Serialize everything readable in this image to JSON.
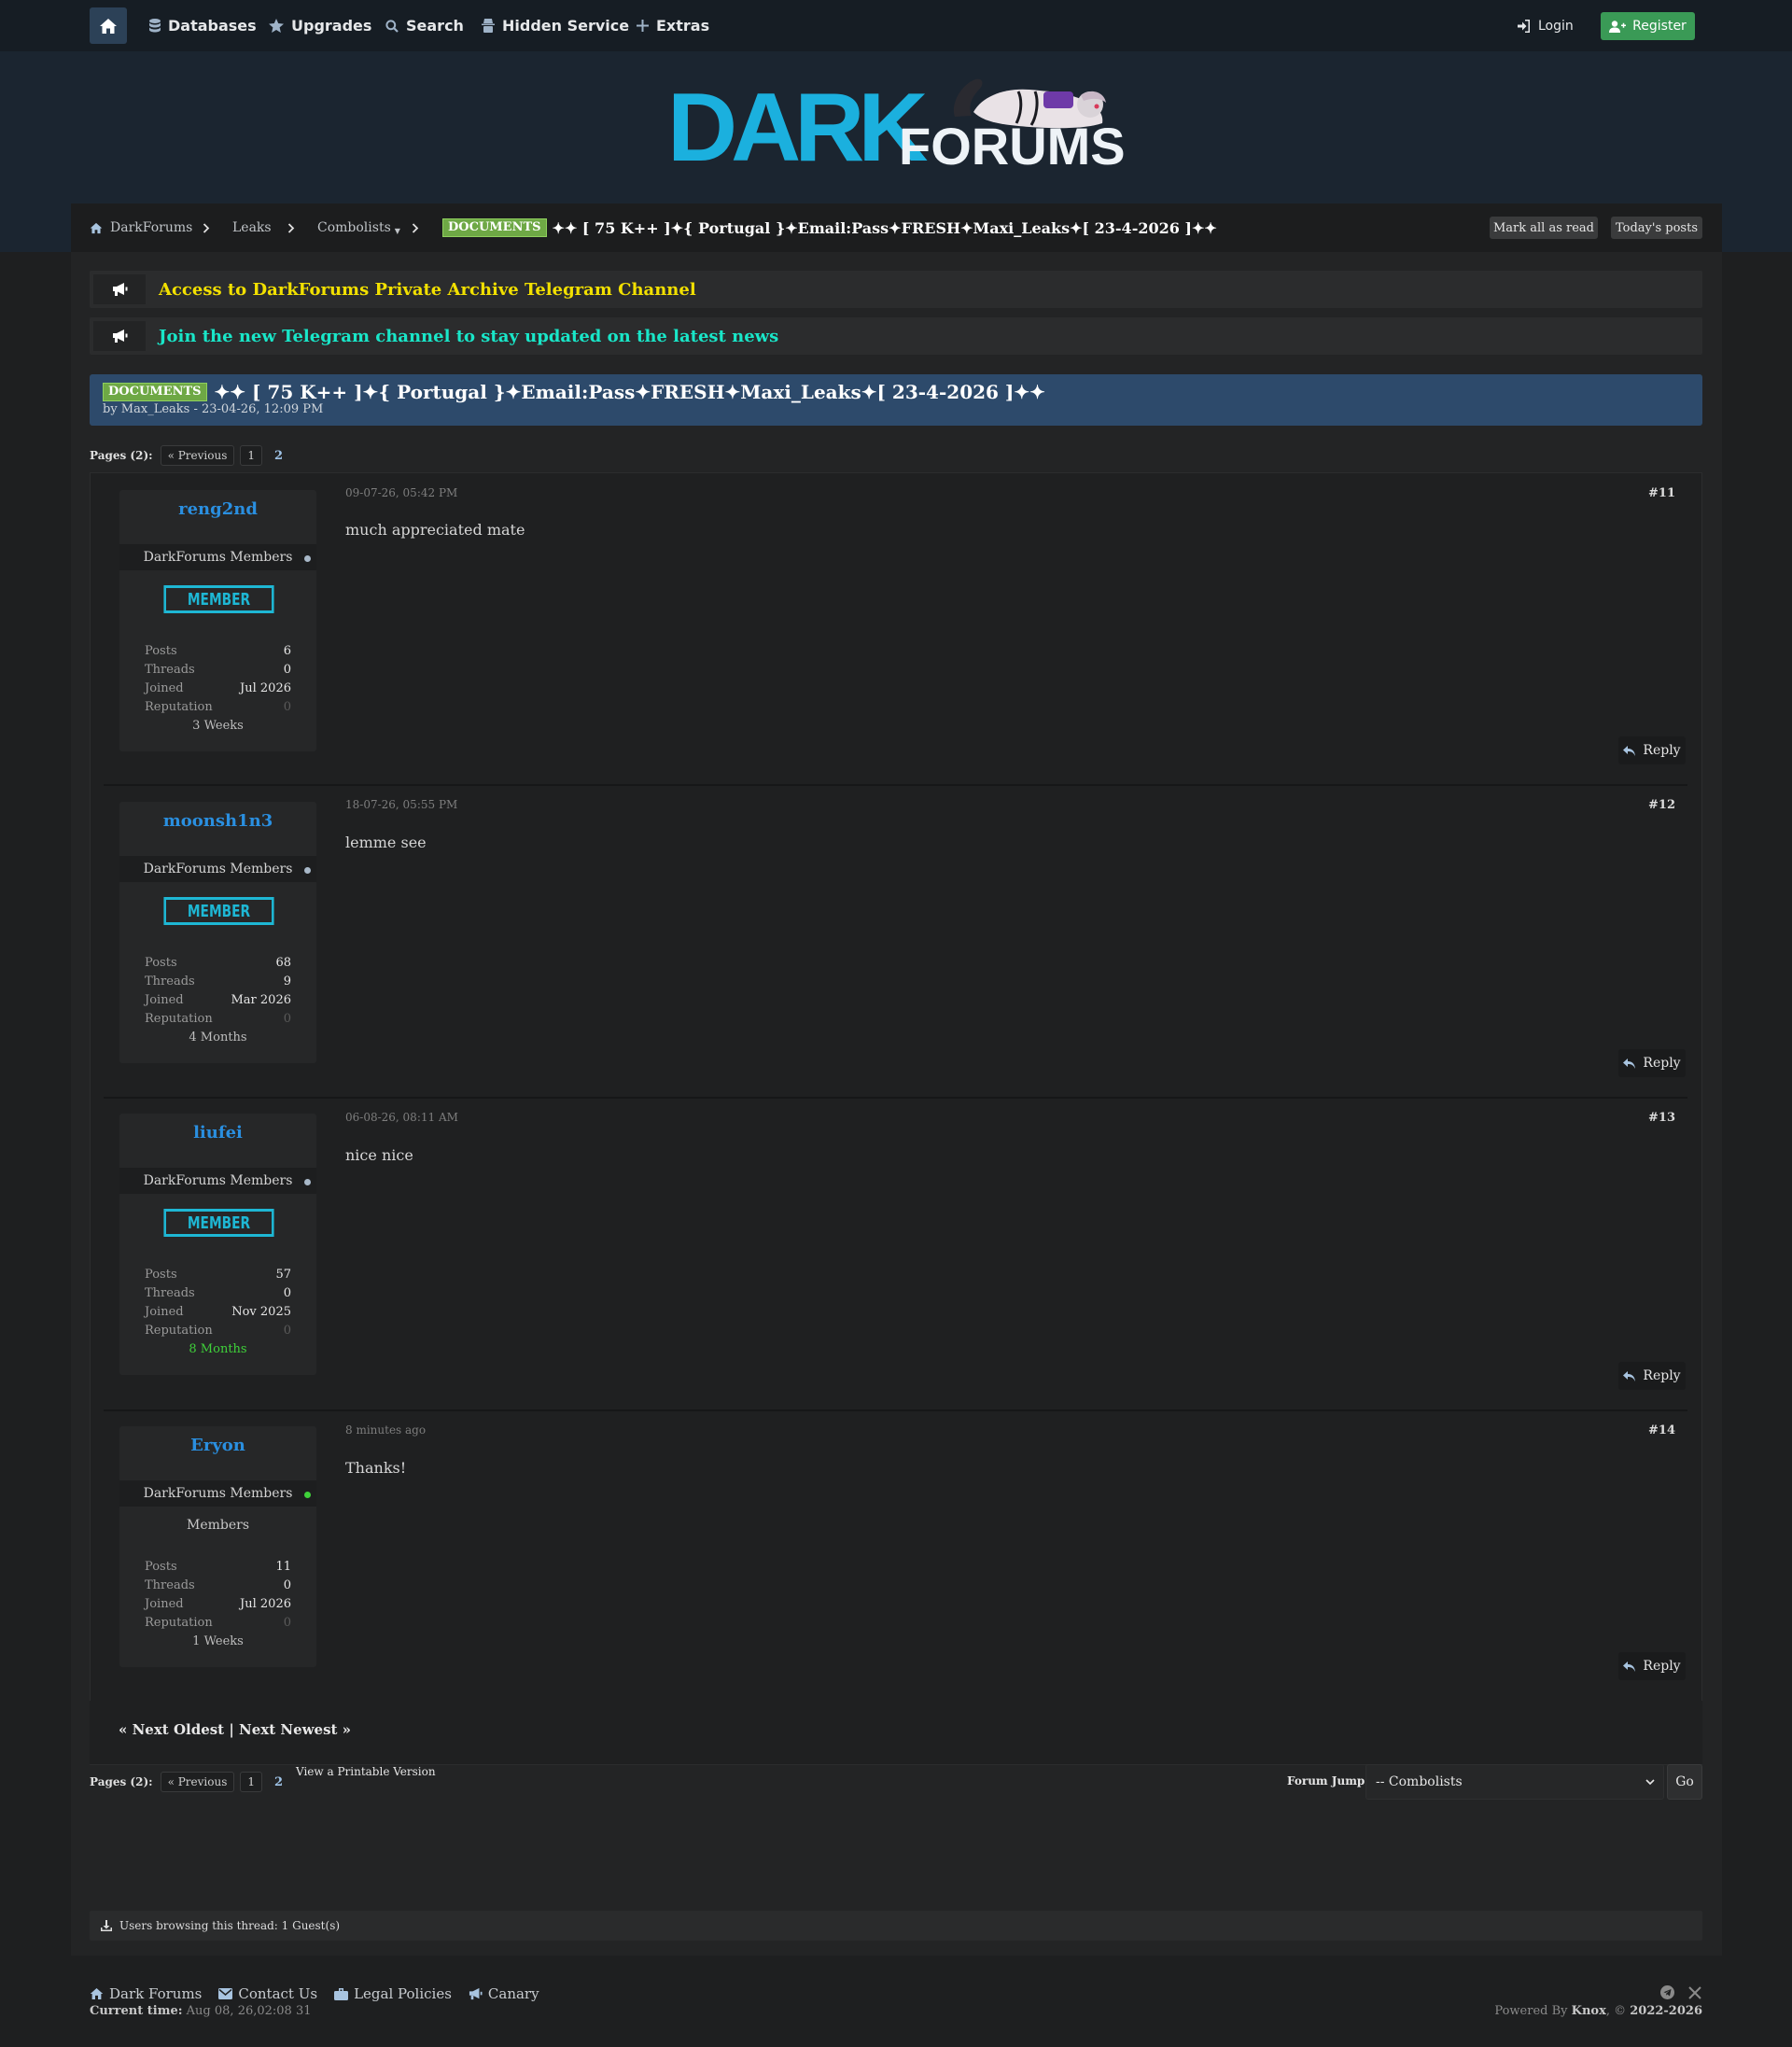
{
  "nav": {
    "items": [
      "Databases",
      "Upgrades",
      "Search",
      "Hidden Service",
      "Extras"
    ],
    "login": "Login",
    "register": "Register"
  },
  "logo": {
    "dark": "DARK",
    "forums": "FORUMS"
  },
  "breadcrumb": {
    "items": [
      "DarkForums",
      "Leaks",
      "Combolists"
    ],
    "combolists_marker": "▼",
    "prefix": "DOCUMENTS",
    "current": "✦✦ [ 75 K++ ]✦{ Portugal }✦Email:Pass✦FRESH✦Maxi_Leaks✦[ 23-4-2026 ]✦✦",
    "mark_all_read": "Mark all as read",
    "todays_posts": "Today's posts"
  },
  "announcements": [
    {
      "text": "Access to DarkForums Private Archive Telegram Channel",
      "color": "#f2e000"
    },
    {
      "text": "Join the new Telegram channel to stay updated on the latest news",
      "color": "#19e6c8"
    }
  ],
  "thread": {
    "prefix": "DOCUMENTS",
    "title": "✦✦ [ 75 K++ ]✦{ Portugal }✦Email:Pass✦FRESH✦Maxi_Leaks✦[ 23-4-2026 ]✦✦",
    "byline": "by Max_Leaks - 23-04-26, 12:09 PM"
  },
  "pagination": {
    "label": "Pages (2):",
    "previous": "« Previous",
    "pages": [
      "1",
      "2"
    ]
  },
  "post_labels": {
    "posts": "Posts",
    "threads": "Threads",
    "joined": "Joined",
    "reputation": "Reputation",
    "reply": "Reply"
  },
  "posts": [
    {
      "username": "reng2nd",
      "group": "DarkForums Members",
      "badge": "MEMBER",
      "online": false,
      "posts": "6",
      "threads": "0",
      "joined": "Jul 2026",
      "reputation": "0",
      "tenure": "3 Weeks",
      "date": "09-07-26, 05:42 PM",
      "number": "#11",
      "body": "much appreciated mate"
    },
    {
      "username": "moonsh1n3",
      "group": "DarkForums Members",
      "badge": "MEMBER",
      "online": false,
      "posts": "68",
      "threads": "9",
      "joined": "Mar 2026",
      "reputation": "0",
      "tenure": "4 Months",
      "date": "18-07-26, 05:55 PM",
      "number": "#12",
      "body": "lemme see"
    },
    {
      "username": "liufei",
      "group": "DarkForums Members",
      "badge": "MEMBER",
      "online": false,
      "posts": "57",
      "threads": "0",
      "joined": "Nov 2025",
      "reputation": "0",
      "tenure": "8 Months",
      "date": "06-08-26, 08:11 AM",
      "number": "#13",
      "body": "nice nice"
    },
    {
      "username": "Eryon",
      "group": "DarkForums Members",
      "group_text": "Members",
      "online": true,
      "posts": "11",
      "threads": "0",
      "joined": "Jul 2026",
      "reputation": "0",
      "tenure": "1 Weeks",
      "date": "8 minutes ago",
      "number": "#14",
      "body": "Thanks!"
    }
  ],
  "next_links": "« Next Oldest | Next Newest »",
  "printable": "View a Printable Version",
  "forum_jump": {
    "label": "Forum Jump:",
    "selected": "-- Combolists",
    "go": "Go"
  },
  "browsing": "Users browsing this thread: 1 Guest(s)",
  "footer": {
    "links": [
      "Dark Forums",
      "Contact Us",
      "Legal Policies",
      "Canary"
    ],
    "current_time_label": "Current time:",
    "current_time": "Aug 08, 26,02:08 31",
    "powered_prefix": "Powered By",
    "powered_name": "Knox",
    "copyright_prefix": ", ©",
    "years": "2022-2026"
  },
  "colors": {
    "accent": "#2a8fe0",
    "prefix_green": "#6ea845",
    "badge_cyan": "#1eb7d4",
    "register_green": "#3a9a56",
    "online_green": "#3fd13a"
  }
}
